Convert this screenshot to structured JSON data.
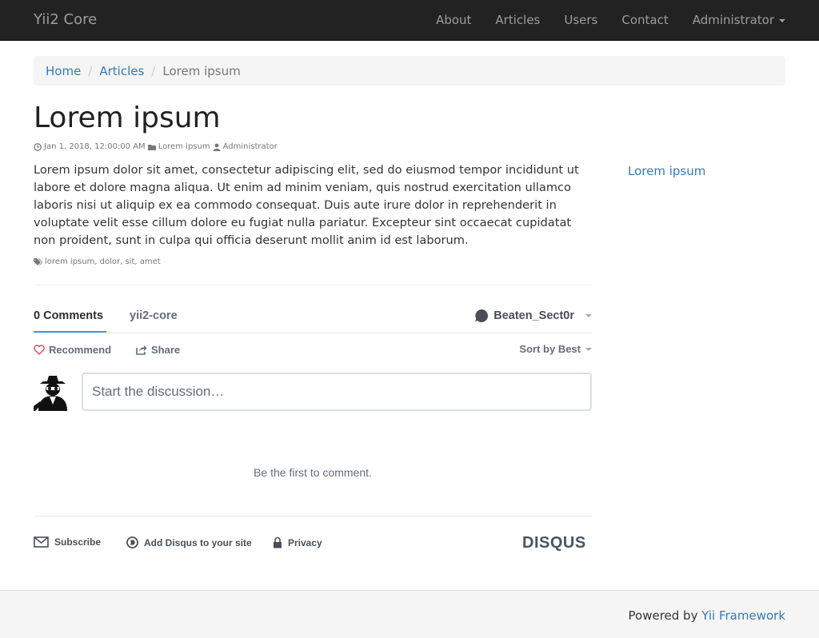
{
  "navbar": {
    "brand": "Yii2 Core",
    "items": [
      "About",
      "Articles",
      "Users",
      "Contact"
    ],
    "admin": "Administrator"
  },
  "breadcrumb": {
    "home": "Home",
    "articles": "Articles",
    "current": "Lorem ipsum"
  },
  "article": {
    "title": "Lorem ipsum",
    "date": "Jan 1, 2018, 12:00:00 AM",
    "category": "Lorem ipsum",
    "author": "Administrator",
    "body": "Lorem ipsum dolor sit amet, consectetur adipiscing elit, sed do eiusmod tempor incididunt ut labore et dolore magna aliqua. Ut enim ad minim veniam, quis nostrud exercitation ullamco laboris nisi ut aliquip ex ea commodo consequat. Duis aute irure dolor in reprehenderit in voluptate velit esse cillum dolore eu fugiat nulla pariatur. Excepteur sint occaecat cupidatat non proident, sunt in culpa qui officia deserunt mollit anim id est laborum.",
    "tags": "lorem ipsum, dolor, sit, amet"
  },
  "sidebar": {
    "link": "Lorem ipsum"
  },
  "disqus": {
    "tab_comments": "0 Comments",
    "tab_forum": "yii2-core",
    "user": "Beaten_Sect0r",
    "recommend": "Recommend",
    "share": "Share",
    "sort": "Sort by Best",
    "input_placeholder": "Start the discussion…",
    "empty": "Be the first to comment.",
    "subscribe": "Subscribe",
    "add": "Add Disqus to your site",
    "privacy": "Privacy",
    "logo": "DISQUS"
  },
  "footer": {
    "prefix": "Powered by ",
    "link": "Yii Framework"
  }
}
